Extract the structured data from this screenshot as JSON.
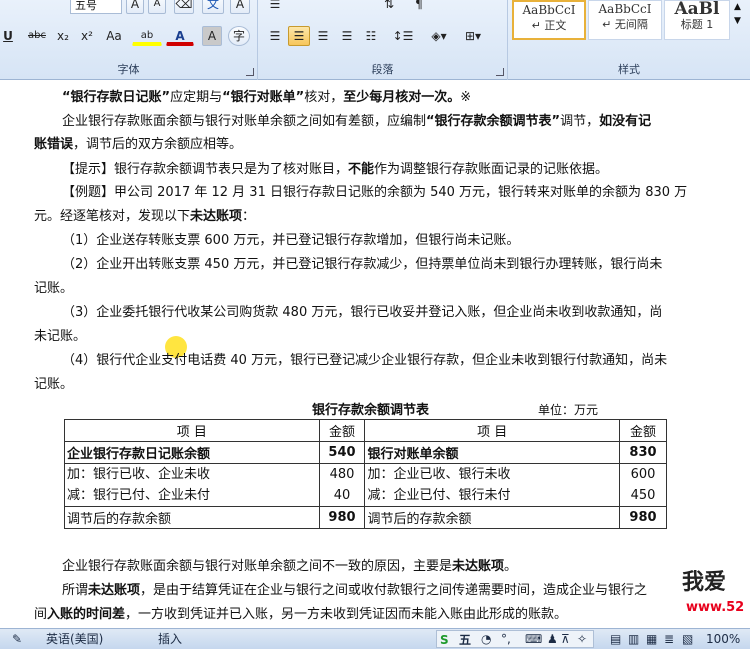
{
  "ribbon": {
    "font_group": {
      "label": "字体",
      "font_size": "五号",
      "buttons": {
        "shrink_font": "A",
        "grow_font": "A",
        "clear_format": "⌫",
        "phonetic": "文",
        "border_char": "A",
        "underline": "U",
        "strikethrough": "abc",
        "subscript": "x₂",
        "superscript": "x²",
        "change_case": "Aa",
        "highlight": "ab",
        "font_color": "A",
        "char_shading": "A",
        "enclose_char": "字"
      },
      "highlight_color": "#ffff00",
      "font_color_value": "#d00000"
    },
    "paragraph_group": {
      "label": "段落"
    },
    "styles_group": {
      "label": "样式",
      "tiles": [
        {
          "sample": "AaBbCcI",
          "name": "↵ 正文"
        },
        {
          "sample": "AaBbCcI",
          "name": "↵ 无间隔"
        },
        {
          "sample": "AaBl",
          "name": "标题 1"
        }
      ]
    }
  },
  "document": {
    "line1": {
      "a": "“银行存款日记账”",
      "b": "应定期与",
      "c": "“银行对账单”",
      "d": "核对，",
      "e": "至少每月核对一次。",
      "f": "※"
    },
    "para2": {
      "a": "企业银行存款账面余额与银行对账单余额之间如有差额，应编制",
      "b": "“银行存款余额调节表”",
      "c": "调节，",
      "d": "如没有记",
      "e": "账错误",
      "f": "，调节后的双方余额应相等。"
    },
    "tip": {
      "a": "【提示】",
      "b": "银行存款余额调节表只是为了核对账目，",
      "c": "不能",
      "d": "作为调整银行存款账面记录的记账依据。"
    },
    "example": {
      "a": "【例题】",
      "b": "甲公司 2017 年 12 月 31 日银行存款日记账的余额为 540 万元，银行转来对账单的余额为 830 万",
      "c": "元。经逐笔核对，发现以下",
      "d": "未达账项",
      "e": "："
    },
    "items": {
      "i1": "（1）企业送存转账支票 600 万元，并已登记银行存款增加，但银行尚未记账。",
      "i2a": "（2）企业开出转账支票 450 万元，并已登记银行存款减少，但持票单位尚未到银行办理转账，银行尚未",
      "i2b": "记账。",
      "i3a": "（3）企业委托银行代收某公司购货款 480 万元，银行已收妥并登记入账，但企业尚未收到收款通知，尚",
      "i3b": "未记账。",
      "i4a": "（4）银行代企业支付电话费 40 万元，银行已登记减少企业银行存款，但企业未收到银行付款通知，尚未",
      "i4b": "记账。"
    },
    "table": {
      "title": "银行存款余额调节表",
      "unit": "单位：万元",
      "header": {
        "item": "项 目",
        "amount": "金额"
      },
      "rows": {
        "r1": {
          "left": "企业银行存款日记账余额",
          "left_amt": "540",
          "right": "银行对账单余额",
          "right_amt": "830"
        },
        "r2": {
          "left_add": "加：银行已收、企业未收",
          "left_add_amt": "480",
          "left_sub": "减：银行已付、企业未付",
          "left_sub_amt": "40",
          "right_add": "加：企业已收、银行未收",
          "right_add_amt": "600",
          "right_sub": "减：企业已付、银行未付",
          "right_sub_amt": "450"
        },
        "r3": {
          "left": "调节后的存款余额",
          "left_amt": "980",
          "right": "调节后的存款余额",
          "right_amt": "980"
        }
      }
    },
    "bottom1": {
      "a": "企业银行存款账面余额与银行对账单余额之间不一致的原因，主要是",
      "b": "未达账项",
      "c": "。"
    },
    "bottom2": {
      "a": "所谓",
      "b": "未达账项",
      "c": "，是由于结算凭证在企业与银行之间或收付款银行之间传递需要时间，造成企业与银行之",
      "d": "间",
      "e": "入账的时间差",
      "f": "，一方收到凭证并已入账，另一方未收到凭证因而未能入账由此形成的账款。"
    },
    "watermark": {
      "text": "我爱",
      "url": "www.52"
    }
  },
  "statusbar": {
    "language": "英语(美国)",
    "mode": "插入",
    "ime": "五",
    "zoom": "100%"
  },
  "colors": {
    "accent": "#2b579a",
    "highlight": "#ffdc00",
    "watermark_red": "#e8001c"
  }
}
